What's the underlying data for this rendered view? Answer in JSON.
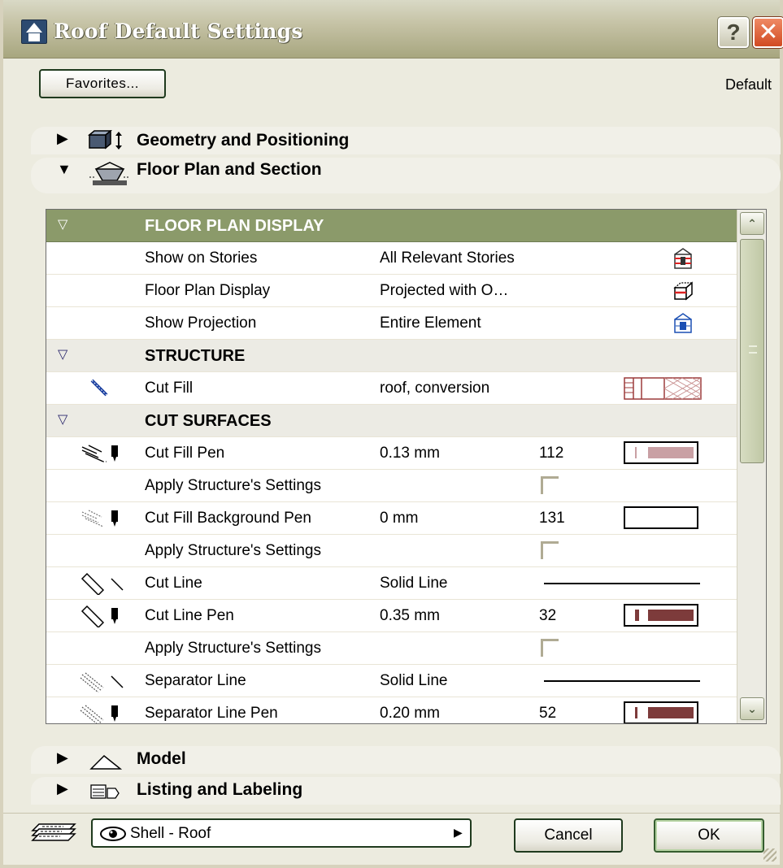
{
  "window": {
    "title": "Roof Default Settings",
    "help_label": "?",
    "close_label": "✕"
  },
  "toolbar": {
    "favorites_label": "Favorites...",
    "default_label": "Default"
  },
  "panels": {
    "geometry": {
      "title": "Geometry and Positioning",
      "expanded": false
    },
    "floor_plan": {
      "title": "Floor Plan and Section",
      "expanded": true
    },
    "model": {
      "title": "Model",
      "expanded": false
    },
    "listing": {
      "title": "Listing and Labeling",
      "expanded": false
    }
  },
  "table": {
    "groups": {
      "floor_plan_display": "FLOOR PLAN DISPLAY",
      "structure": "STRUCTURE",
      "cut_surfaces": "CUT SURFACES"
    },
    "rows": {
      "show_on_stories": {
        "label": "Show on Stories",
        "value": "All Relevant Stories"
      },
      "floor_plan_display": {
        "label": "Floor Plan Display",
        "value": "Projected with O…"
      },
      "show_projection": {
        "label": "Show Projection",
        "value": "Entire Element"
      },
      "cut_fill": {
        "label": "Cut Fill",
        "value": "roof, conversion"
      },
      "cut_fill_pen": {
        "label": "Cut Fill Pen",
        "value": "0.13 mm",
        "pen": "112",
        "color": "#c9a0a4"
      },
      "apply_1": {
        "label": "Apply Structure's Settings",
        "checked": false
      },
      "cut_fill_bg_pen": {
        "label": "Cut Fill Background Pen",
        "value": "0 mm",
        "pen": "131",
        "color": "#ffffff"
      },
      "apply_2": {
        "label": "Apply Structure's Settings",
        "checked": false
      },
      "cut_line": {
        "label": "Cut Line",
        "value": "Solid Line"
      },
      "cut_line_pen": {
        "label": "Cut Line Pen",
        "value": "0.35 mm",
        "pen": "32",
        "color": "#7d3b3b"
      },
      "apply_3": {
        "label": "Apply Structure's Settings",
        "checked": false
      },
      "separator_line": {
        "label": "Separator Line",
        "value": "Solid Line"
      },
      "separator_line_pen": {
        "label": "Separator Line Pen",
        "value": "0.20 mm",
        "pen": "52",
        "color": "#7d3b3b"
      }
    }
  },
  "footer": {
    "layer_value": "Shell - Roof",
    "cancel_label": "Cancel",
    "ok_label": "OK"
  },
  "colors": {
    "group_header": "#8b9a6a",
    "dialog_bg": "#ecebdf",
    "titlebar": "#a7a67f"
  }
}
